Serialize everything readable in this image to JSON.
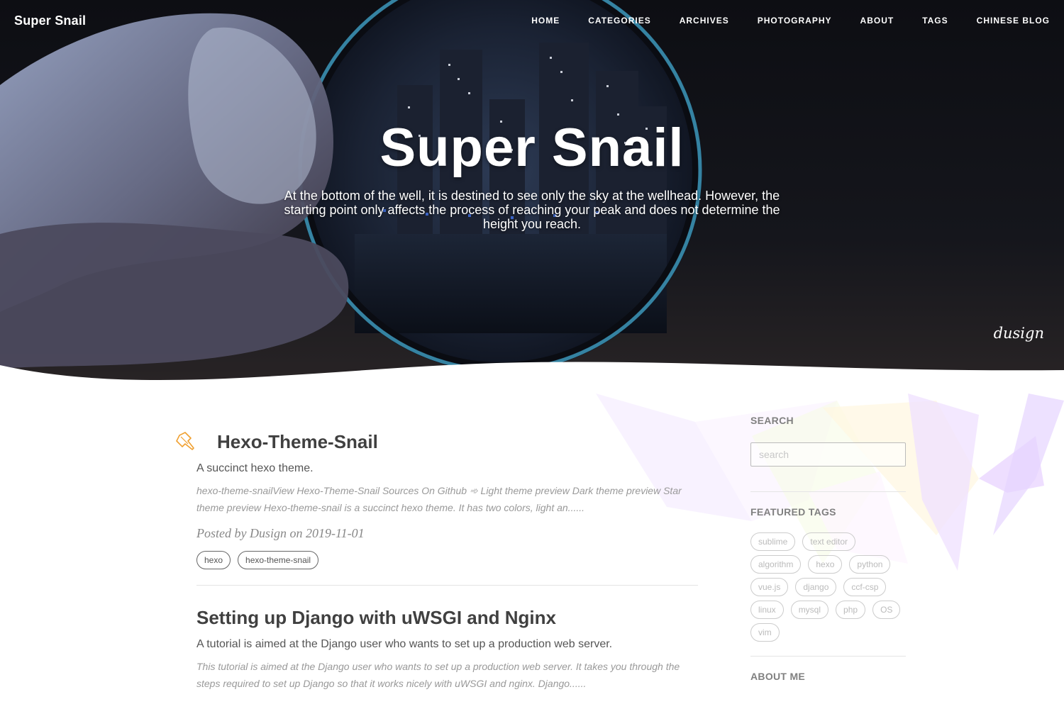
{
  "nav": {
    "brand": "Super Snail",
    "items": [
      {
        "label": "HOME"
      },
      {
        "label": "CATEGORIES"
      },
      {
        "label": "ARCHIVES"
      },
      {
        "label": "PHOTOGRAPHY"
      },
      {
        "label": "ABOUT"
      },
      {
        "label": "TAGS"
      },
      {
        "label": "CHINESE BLOG"
      }
    ]
  },
  "hero": {
    "title": "Super Snail",
    "subtitle": "At the bottom of the well, it is destined to see only the sky at the wellhead. However, the starting point only affects the process of reaching your peak and does not determine the height you reach.",
    "watermark": "dusign"
  },
  "posts": [
    {
      "title": "Hexo-Theme-Snail",
      "subtitle": "A succinct hexo theme.",
      "excerpt": "hexo-theme-snailView Hexo-Theme-Snail Sources On Github ➾ Light theme preview Dark theme preview Star theme preview Hexo-theme-snail is a succinct hexo theme. It has two colors, light an......",
      "meta": "Posted by Dusign on 2019-11-01",
      "tags": [
        "hexo",
        "hexo-theme-snail"
      ],
      "pinned": true
    },
    {
      "title": "Setting up Django with uWSGI and Nginx",
      "subtitle": "A tutorial is aimed at the Django user who wants to set up a production web server.",
      "excerpt": "This tutorial is aimed at the Django user who wants to set up a production web server. It takes you through the steps required to set up Django so that it works nicely with uWSGI and nginx. Django......"
    }
  ],
  "sidebar": {
    "search_heading": "SEARCH",
    "search_placeholder": "search",
    "featured_heading": "FEATURED TAGS",
    "featured_tags": [
      "sublime",
      "text editor",
      "algorithm",
      "hexo",
      "python",
      "vue.js",
      "django",
      "ccf-csp",
      "linux",
      "mysql",
      "php",
      "OS",
      "vim"
    ],
    "about_heading": "ABOUT ME"
  },
  "colors": {
    "accent_pin": "#f0a030",
    "text_dark": "#404040",
    "muted": "#999999"
  }
}
